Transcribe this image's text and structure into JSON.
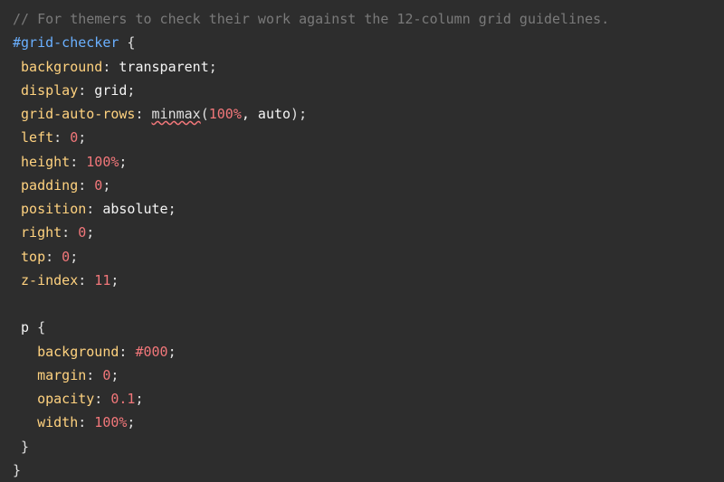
{
  "code": {
    "comment": "// For themers to check their work against the 12-column grid guidelines.",
    "selector": "#grid-checker",
    "brace_open": " {",
    "brace_close": "}",
    "rules": {
      "r1": {
        "prop": "background",
        "val": "transparent"
      },
      "r2": {
        "prop": "display",
        "val": "grid"
      },
      "r3": {
        "prop": "grid-auto-rows",
        "func": "minmax",
        "arg1": "100%",
        "comma": ", ",
        "arg2": "auto",
        "close": ")"
      },
      "r4": {
        "prop": "left",
        "val": "0"
      },
      "r5": {
        "prop": "height",
        "val": "100%"
      },
      "r6": {
        "prop": "padding",
        "val": "0"
      },
      "r7": {
        "prop": "position",
        "val": "absolute"
      },
      "r8": {
        "prop": "right",
        "val": "0"
      },
      "r9": {
        "prop": "top",
        "val": "0"
      },
      "r10": {
        "prop": "z-index",
        "val": "11"
      }
    },
    "nested": {
      "selector": "p",
      "r1": {
        "prop": "background",
        "val": "#000"
      },
      "r2": {
        "prop": "margin",
        "val": "0"
      },
      "r3": {
        "prop": "opacity",
        "val": "0.1"
      },
      "r4": {
        "prop": "width",
        "val": "100%"
      }
    },
    "colon": ": ",
    "semi": ";",
    "lparen": "("
  }
}
